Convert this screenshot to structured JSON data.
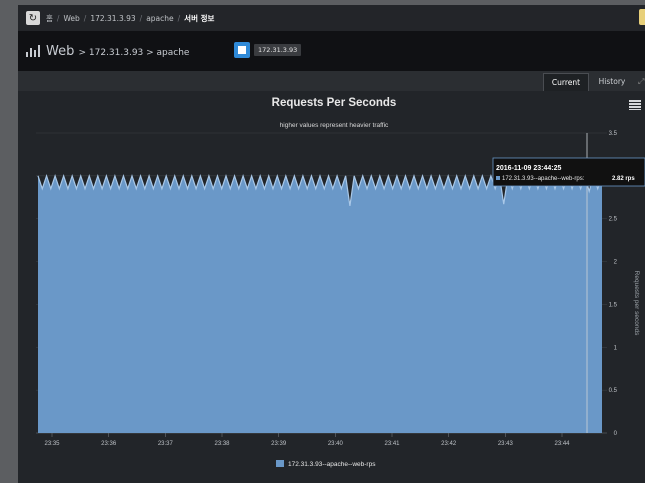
{
  "breadcrumb": {
    "home": "홈",
    "items": [
      "Web",
      "172.31.3.93",
      "apache"
    ],
    "current": "서버 정보"
  },
  "header": {
    "title": "Web",
    "path": "> 172.31.3.93 > apache",
    "host_tag": "172.31.3.93"
  },
  "tabs": {
    "current": "Current",
    "history": "History"
  },
  "chart_data": {
    "type": "area",
    "title": "Requests Per Seconds",
    "subtitle": "higher values represent heavier traffic",
    "ylabel": "Requests per seconds",
    "ylim": [
      0,
      3.5
    ],
    "yticks": [
      "0",
      "0.5",
      "1",
      "1.5",
      "2",
      "2.5",
      "3",
      "3.5"
    ],
    "x_ticks": [
      "23:35",
      "23:36",
      "23:37",
      "23:38",
      "23:39",
      "23:40",
      "23:41",
      "23:42",
      "23:43",
      "23:44"
    ],
    "series": [
      {
        "name": "172.31.3.93--apache--web-rps",
        "color": "#6a98c8",
        "values": [
          3.0,
          2.85,
          3.0,
          2.85,
          3.0,
          2.85,
          3.0,
          2.85,
          3.0,
          2.85,
          3.0,
          2.85,
          3.0,
          2.85,
          3.0,
          2.85,
          3.0,
          2.85,
          3.0,
          2.85,
          3.0,
          2.85,
          3.0,
          2.85,
          3.0,
          2.85,
          3.0,
          2.85,
          3.0,
          2.85,
          3.0,
          2.85,
          3.0,
          2.85,
          3.0,
          2.85,
          3.0,
          2.85,
          3.0,
          2.85,
          3.0,
          2.85,
          3.0,
          2.85,
          3.0,
          2.85,
          3.0,
          2.85,
          3.0,
          2.85,
          3.0,
          2.85,
          3.0,
          2.85,
          3.0,
          2.85,
          3.0,
          2.85,
          3.0,
          2.85,
          3.0,
          2.85,
          3.0,
          2.85,
          3.0,
          2.85,
          3.0,
          2.85,
          3.0,
          2.85,
          3.0,
          2.85,
          3.0,
          2.65,
          3.0,
          2.85,
          3.0,
          2.85,
          3.0,
          2.85,
          3.0,
          2.85,
          3.0,
          2.85,
          3.0,
          2.85,
          3.0,
          2.85,
          3.0,
          2.85,
          3.0,
          2.85,
          3.0,
          2.85,
          3.0,
          2.85,
          3.0,
          2.85,
          3.0,
          2.85,
          3.0,
          2.85,
          3.0,
          2.85,
          3.0,
          2.85,
          3.0,
          2.85,
          3.0,
          2.67,
          3.0,
          2.85,
          3.0,
          2.85,
          3.0,
          2.85,
          3.0,
          2.85,
          3.0,
          2.85,
          3.0,
          2.85,
          3.0,
          2.85,
          3.0,
          2.85,
          3.0,
          2.85,
          3.0,
          2.82,
          3.0,
          2.85,
          3.0
        ]
      }
    ],
    "tooltip": {
      "time": "2016-11-09 23:44:25",
      "series": "172.31.3.93--apache--web-rps:",
      "value": "2.82 rps"
    },
    "legend": "172.31.3.93--apache--web-rps",
    "legend_position": "bottom"
  }
}
